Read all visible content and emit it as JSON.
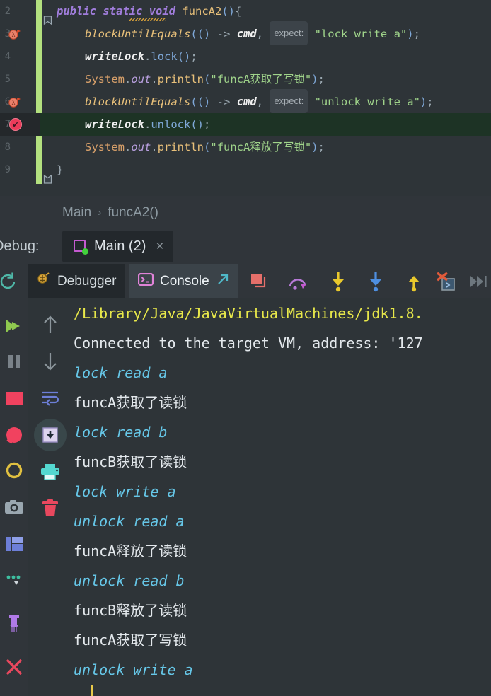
{
  "theme": {
    "editor_bg": "#2e3438",
    "panel_bg": "#30353a",
    "exec_line_bg": "#1d3325",
    "changebar": "#b3e07f",
    "accent_magenta": "#c45ad0",
    "accent_green": "#42d13c",
    "string_green": "#9fd38a",
    "console_yellow": "#e8e84a",
    "console_cyan": "#66c7e8",
    "breakpoint_red": "#eb3b5a",
    "lambda_orange": "#e8704a"
  },
  "editor": {
    "lines": [
      {
        "number": "2",
        "indent": 0,
        "gutter_icon": "",
        "exec": false,
        "tokens": [
          {
            "t": "public ",
            "c": "kw"
          },
          {
            "t": "static ",
            "c": "kw"
          },
          {
            "t": "void ",
            "c": "kw"
          },
          {
            "t": "funcA2",
            "c": "mth"
          },
          {
            "t": "()",
            "c": "pn"
          },
          {
            "t": "{",
            "c": "op"
          }
        ],
        "warning_underline": true,
        "fold": "fold-open"
      },
      {
        "number": "3",
        "indent": 1,
        "gutter_icon": "lambda-breakpoint-icon",
        "exec": false,
        "tokens": [
          {
            "t": "blockUntilEquals",
            "c": "mth-i"
          },
          {
            "t": "((",
            "c": "pn"
          },
          {
            "t": ")",
            "c": "pn"
          },
          {
            "t": " -> ",
            "c": "op"
          },
          {
            "t": "cmd",
            "c": "lamb"
          },
          {
            "t": ", ",
            "c": "op"
          }
        ],
        "hint": "expect:",
        "after_hint": [
          {
            "t": "\"lock write a\"",
            "c": "str"
          },
          {
            "t": ")",
            "c": "pn"
          },
          {
            "t": ";",
            "c": "op"
          }
        ]
      },
      {
        "number": "4",
        "indent": 1,
        "gutter_icon": "",
        "exec": false,
        "tokens": [
          {
            "t": "writeLock",
            "c": "fld"
          },
          {
            "t": ".",
            "c": "op"
          },
          {
            "t": "lock",
            "c": "pn"
          },
          {
            "t": "()",
            "c": "pn"
          },
          {
            "t": ";",
            "c": "op"
          }
        ]
      },
      {
        "number": "5",
        "indent": 1,
        "gutter_icon": "",
        "exec": false,
        "tokens": [
          {
            "t": "System",
            "c": "cls"
          },
          {
            "t": ".",
            "c": "op"
          },
          {
            "t": "out",
            "c": "stat"
          },
          {
            "t": ".",
            "c": "op"
          },
          {
            "t": "println",
            "c": "mth"
          },
          {
            "t": "(",
            "c": "pn"
          },
          {
            "t": "\"funcA获取了写锁\"",
            "c": "str"
          },
          {
            "t": ")",
            "c": "pn"
          },
          {
            "t": ";",
            "c": "op"
          }
        ]
      },
      {
        "number": "6",
        "indent": 1,
        "gutter_icon": "lambda-breakpoint-icon",
        "exec": false,
        "tokens": [
          {
            "t": "blockUntilEquals",
            "c": "mth-i"
          },
          {
            "t": "((",
            "c": "pn"
          },
          {
            "t": ")",
            "c": "pn"
          },
          {
            "t": " -> ",
            "c": "op"
          },
          {
            "t": "cmd",
            "c": "lamb"
          },
          {
            "t": ", ",
            "c": "op"
          }
        ],
        "hint": "expect:",
        "after_hint": [
          {
            "t": "\"unlock write a\"",
            "c": "str"
          },
          {
            "t": ")",
            "c": "pn"
          },
          {
            "t": ";",
            "c": "op"
          }
        ]
      },
      {
        "number": "7",
        "indent": 1,
        "gutter_icon": "verified-breakpoint-icon",
        "exec": true,
        "tokens": [
          {
            "t": "writeLock",
            "c": "fld"
          },
          {
            "t": ".",
            "c": "op"
          },
          {
            "t": "unlock",
            "c": "pn"
          },
          {
            "t": "()",
            "c": "pn"
          },
          {
            "t": ";",
            "c": "op"
          }
        ]
      },
      {
        "number": "8",
        "indent": 1,
        "gutter_icon": "",
        "exec": false,
        "tokens": [
          {
            "t": "System",
            "c": "cls"
          },
          {
            "t": ".",
            "c": "op"
          },
          {
            "t": "out",
            "c": "stat"
          },
          {
            "t": ".",
            "c": "op"
          },
          {
            "t": "println",
            "c": "mth"
          },
          {
            "t": "(",
            "c": "pn"
          },
          {
            "t": "\"funcA释放了写锁\"",
            "c": "str"
          },
          {
            "t": ")",
            "c": "pn"
          },
          {
            "t": ";",
            "c": "op"
          }
        ]
      },
      {
        "number": "9",
        "indent": 0,
        "gutter_icon": "",
        "exec": false,
        "tokens": [
          {
            "t": "}",
            "c": "op"
          }
        ],
        "fold": "fold-close"
      }
    ]
  },
  "breadcrumb": {
    "items": [
      "Main",
      "funcA2()"
    ],
    "separator": "›"
  },
  "debug_header": {
    "label": "Debug:",
    "tab": {
      "title": "Main (2)",
      "close": "×",
      "run_state": "running"
    }
  },
  "tool_tabs": {
    "restart_tooltip": "Rerun",
    "tabs": [
      {
        "label": "Debugger",
        "active": false,
        "icon": "debugger-icon"
      },
      {
        "label": "Console",
        "active": true,
        "icon": "terminal-icon"
      }
    ],
    "external_link_icon": "open-in-new-window-icon",
    "toolbar": [
      {
        "name": "show-execution-point-button",
        "icon": "show-execution-point-icon",
        "enabled": true
      },
      {
        "name": "step-over-button",
        "icon": "step-over-icon",
        "enabled": true
      },
      {
        "name": "step-into-button",
        "icon": "step-into-icon",
        "enabled": true
      },
      {
        "name": "force-step-into-button",
        "icon": "force-step-into-icon",
        "enabled": true
      },
      {
        "name": "step-out-button",
        "icon": "step-out-icon",
        "enabled": true
      },
      {
        "name": "drop-frame-button",
        "icon": "drop-frame-icon",
        "enabled": true
      },
      {
        "name": "run-to-cursor-button",
        "icon": "run-to-cursor-icon",
        "enabled": false
      }
    ]
  },
  "console_gutter": [
    {
      "name": "scroll-up-button",
      "icon": "arrow-up-icon",
      "active": false
    },
    {
      "name": "scroll-down-button",
      "icon": "arrow-down-icon",
      "active": false
    },
    {
      "name": "soft-wrap-button",
      "icon": "soft-wrap-icon",
      "active": false
    },
    {
      "name": "scroll-to-end-button",
      "icon": "scroll-to-end-icon",
      "active": true
    },
    {
      "name": "print-button",
      "icon": "printer-icon",
      "active": false
    },
    {
      "name": "clear-all-button",
      "icon": "trash-icon",
      "active": false
    }
  ],
  "console": {
    "lines": [
      {
        "text": "/Library/Java/JavaVirtualMachines/jdk1.8.",
        "color": "c-yellow"
      },
      {
        "text": "Connected to the target VM, address: '127",
        "color": "c-white"
      },
      {
        "text": "lock read a",
        "color": "c-cyan"
      },
      {
        "text": "funcA获取了读锁",
        "color": "c-white"
      },
      {
        "text": "lock read b",
        "color": "c-cyan"
      },
      {
        "text": "funcB获取了读锁",
        "color": "c-white"
      },
      {
        "text": "lock write a",
        "color": "c-cyan"
      },
      {
        "text": "unlock read a",
        "color": "c-cyan"
      },
      {
        "text": "funcA释放了读锁",
        "color": "c-white"
      },
      {
        "text": "unlock read b",
        "color": "c-cyan"
      },
      {
        "text": "funcB释放了读锁",
        "color": "c-white"
      },
      {
        "text": "funcA获取了写锁",
        "color": "c-white"
      },
      {
        "text": "unlock write a",
        "color": "c-cyan"
      }
    ]
  },
  "left_rail": [
    {
      "name": "resume-program-button",
      "icon": "resume-icon",
      "enabled": true
    },
    {
      "name": "pause-program-button",
      "icon": "pause-icon",
      "enabled": false
    },
    {
      "name": "stop-button",
      "icon": "stop-icon",
      "enabled": true
    },
    {
      "name": "mute-breakpoints-button",
      "icon": "mute-breakpoints-icon",
      "enabled": true
    },
    {
      "name": "view-breakpoints-button",
      "icon": "view-breakpoints-icon",
      "enabled": true
    },
    {
      "name": "screenshot-button",
      "icon": "camera-icon",
      "enabled": true
    },
    {
      "name": "layout-settings-button",
      "icon": "layout-icon",
      "enabled": true
    },
    {
      "name": "more-options-button",
      "icon": "more-dots-icon",
      "enabled": true
    },
    {
      "name": "pin-tab-button",
      "icon": "pin-icon",
      "enabled": true
    },
    {
      "name": "close-panel-button",
      "icon": "close-icon",
      "enabled": true
    }
  ]
}
